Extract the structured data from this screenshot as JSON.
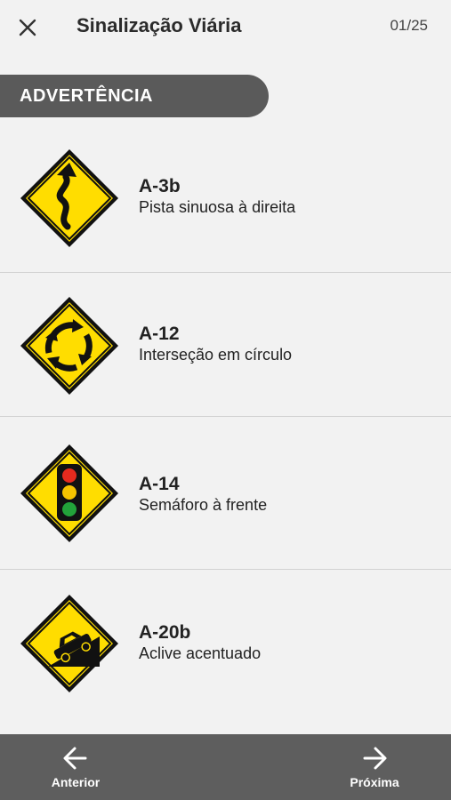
{
  "header": {
    "title": "Sinalização Viária",
    "counter": "01/25",
    "close_icon": "close-icon"
  },
  "section": {
    "label": "ADVERTÊNCIA"
  },
  "signs": [
    {
      "code": "A-3b",
      "description": "Pista sinuosa à direita",
      "icon": "winding-road-right-sign"
    },
    {
      "code": "A-12",
      "description": "Interseção em círculo",
      "icon": "roundabout-sign"
    },
    {
      "code": "A-14",
      "description": "Semáforo à frente",
      "icon": "traffic-light-ahead-sign"
    },
    {
      "code": "A-20b",
      "description": "Aclive acentuado",
      "icon": "steep-ascent-sign"
    }
  ],
  "colors": {
    "sign_yellow": "#ffdd00",
    "sign_border": "#111111",
    "section_bg": "#5a5a5a",
    "bottom_bar_bg": "#5e5e5e",
    "background": "#f2f2f2"
  },
  "navigation": {
    "previous_label": "Anterior",
    "next_label": "Próxima",
    "previous_icon": "arrow-left-icon",
    "next_icon": "arrow-right-icon"
  }
}
